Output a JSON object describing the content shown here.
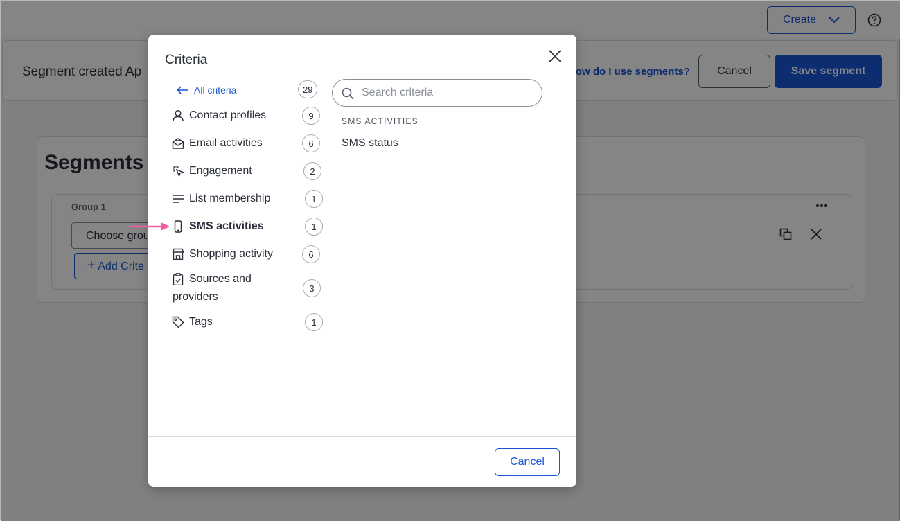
{
  "header": {
    "create_label": "Create"
  },
  "segment_bar": {
    "title": "Segment created Ap",
    "help_link": "How do I use segments?",
    "cancel_label": "Cancel",
    "save_label": "Save segment"
  },
  "builder": {
    "title": "Segments b",
    "group_label": "Group 1",
    "choose_group_label": "Choose grou",
    "add_criteria_label": "Add Crite"
  },
  "modal": {
    "title": "Criteria",
    "back_label": "All criteria",
    "back_count": "29",
    "categories": [
      {
        "label": "Contact profiles",
        "count": "9",
        "icon": "person-icon"
      },
      {
        "label": "Email activities",
        "count": "6",
        "icon": "email-open-icon"
      },
      {
        "label": "Engagement",
        "count": "2",
        "icon": "cursor-click-icon"
      },
      {
        "label": "List membership",
        "count": "1",
        "icon": "list-icon"
      },
      {
        "label": "SMS activities",
        "count": "1",
        "icon": "phone-icon",
        "active": true
      },
      {
        "label": "Shopping activity",
        "count": "6",
        "icon": "store-icon"
      },
      {
        "label": "Sources and providers",
        "count": "3",
        "icon": "clipboard-check-icon"
      },
      {
        "label": "Tags",
        "count": "1",
        "icon": "tag-icon"
      }
    ],
    "search_placeholder": "Search criteria",
    "section_heading": "SMS ACTIVITIES",
    "results": [
      "SMS status"
    ],
    "cancel_label": "Cancel"
  },
  "colors": {
    "primary": "#1856d6",
    "pointer_arrow": "#f25ca2",
    "overlay": "rgba(0,0,0,0.48)"
  }
}
